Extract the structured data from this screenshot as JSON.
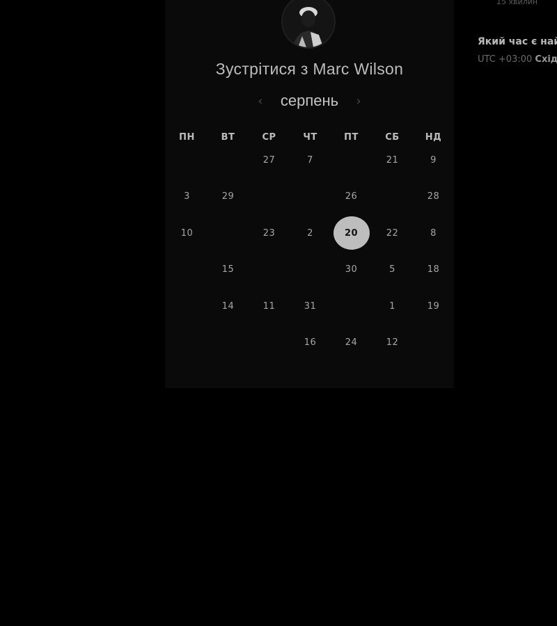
{
  "host": {
    "name_line": "Зустрітися з Marc Wilson"
  },
  "calendar": {
    "month": "серпень",
    "prev_label": "‹",
    "next_label": "›",
    "weekdays": [
      "ПН",
      "ВТ",
      "СР",
      "ЧТ",
      "ПТ",
      "СБ",
      "НД"
    ],
    "days": [
      {
        "label": "",
        "available": false
      },
      {
        "label": "",
        "available": false
      },
      {
        "label": "27",
        "available": true
      },
      {
        "label": "7",
        "available": true
      },
      {
        "label": "",
        "available": false
      },
      {
        "label": "21",
        "available": true
      },
      {
        "label": "9",
        "available": true
      },
      {
        "label": "3",
        "available": true
      },
      {
        "label": "29",
        "available": true
      },
      {
        "label": "",
        "available": false
      },
      {
        "label": "",
        "available": false
      },
      {
        "label": "26",
        "available": true
      },
      {
        "label": "",
        "available": false
      },
      {
        "label": "28",
        "available": true
      },
      {
        "label": "10",
        "available": true
      },
      {
        "label": "",
        "available": false
      },
      {
        "label": "23",
        "available": true
      },
      {
        "label": "2",
        "available": true
      },
      {
        "label": "20",
        "available": true,
        "selected": true
      },
      {
        "label": "22",
        "available": true
      },
      {
        "label": "8",
        "available": true
      },
      {
        "label": "",
        "available": false
      },
      {
        "label": "15",
        "available": true
      },
      {
        "label": "",
        "available": false
      },
      {
        "label": "",
        "available": false
      },
      {
        "label": "30",
        "available": true
      },
      {
        "label": "5",
        "available": true
      },
      {
        "label": "18",
        "available": true
      },
      {
        "label": "",
        "available": false
      },
      {
        "label": "14",
        "available": true
      },
      {
        "label": "11",
        "available": true
      },
      {
        "label": "31",
        "available": true
      },
      {
        "label": "",
        "available": false
      },
      {
        "label": "1",
        "available": true
      },
      {
        "label": "19",
        "available": true
      },
      {
        "label": "",
        "available": false
      },
      {
        "label": "",
        "available": false
      },
      {
        "label": "",
        "available": false
      },
      {
        "label": "16",
        "available": true
      },
      {
        "label": "24",
        "available": true
      },
      {
        "label": "12",
        "available": true
      },
      {
        "label": "",
        "available": false
      }
    ]
  },
  "sidebar": {
    "duration": "15 хвилин",
    "question": "Який час є най",
    "timezone_offset": "UTC +03:00",
    "timezone_name": "Схід"
  },
  "colors": {
    "selected_bg": "#bdbdbd",
    "background": "#000000",
    "card": "#0a0a0a"
  }
}
